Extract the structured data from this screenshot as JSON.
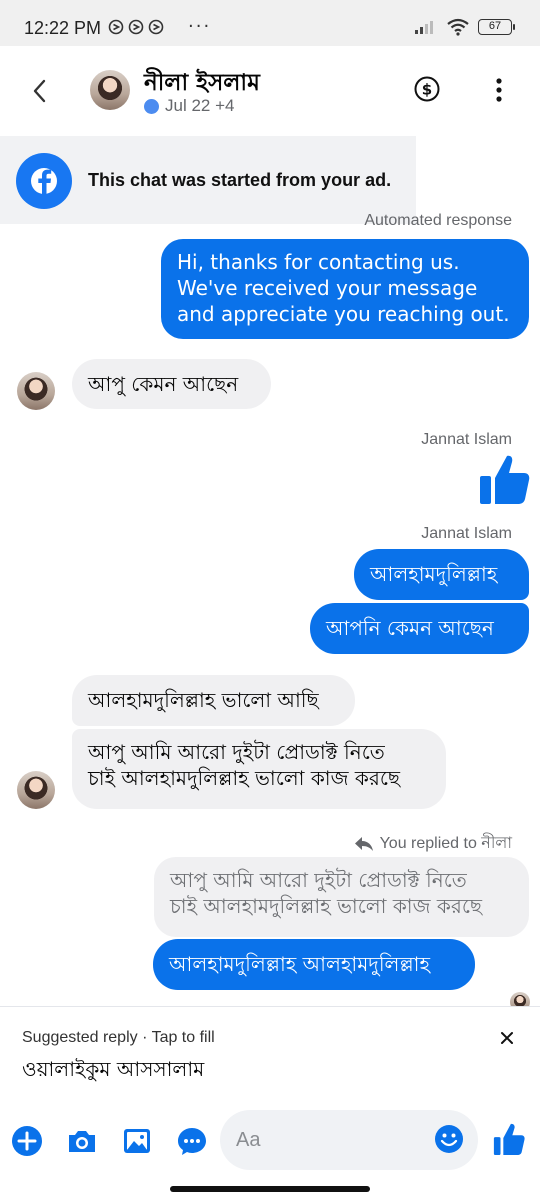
{
  "status_bar": {
    "time": "12:22 PM",
    "battery": "67"
  },
  "header": {
    "contact_name": "নীলা ইসলাম",
    "subtitle": "Jul 22 +4"
  },
  "ad_banner": {
    "text": "This chat was started from your ad."
  },
  "automated_label": "Automated response",
  "messages": {
    "auto_reply": "Hi, thanks for contacting us. We've received your message and appreciate you reaching out.",
    "in_1": "আপু কেমন আছেন",
    "sender_1": "Jannat Islam",
    "sender_2": "Jannat Islam",
    "out_1": "আলহামদুলিল্লাহ",
    "out_2": "আপনি কেমন আছেন",
    "in_2": "আলহামদুলিল্লাহ ভালো আছি",
    "in_3_line1": "আপু আমি আরো দুইটা প্রোডাক্ট নিতে",
    "in_3_line2": "চাই আলহামদুলিল্লাহ ভালো কাজ করছে",
    "replied_to": "You replied to নীলা",
    "quoted_line1": "আপু আমি আরো দুইটা প্রোডাক্ট নিতে",
    "quoted_line2": "চাই আলহামদুলিল্লাহ ভালো কাজ করছে",
    "out_3": "আলহামদুলিল্লাহ আলহামদুলিল্লাহ"
  },
  "suggested_reply": {
    "title": "Suggested reply · Tap to fill",
    "text": "ওয়ালাইকুম আসসালাম"
  },
  "composer": {
    "placeholder": "Aa"
  },
  "colors": {
    "accent": "#0a72ea",
    "facebook_blue": "#1877f2",
    "incoming_bubble": "#f0f0f2"
  }
}
